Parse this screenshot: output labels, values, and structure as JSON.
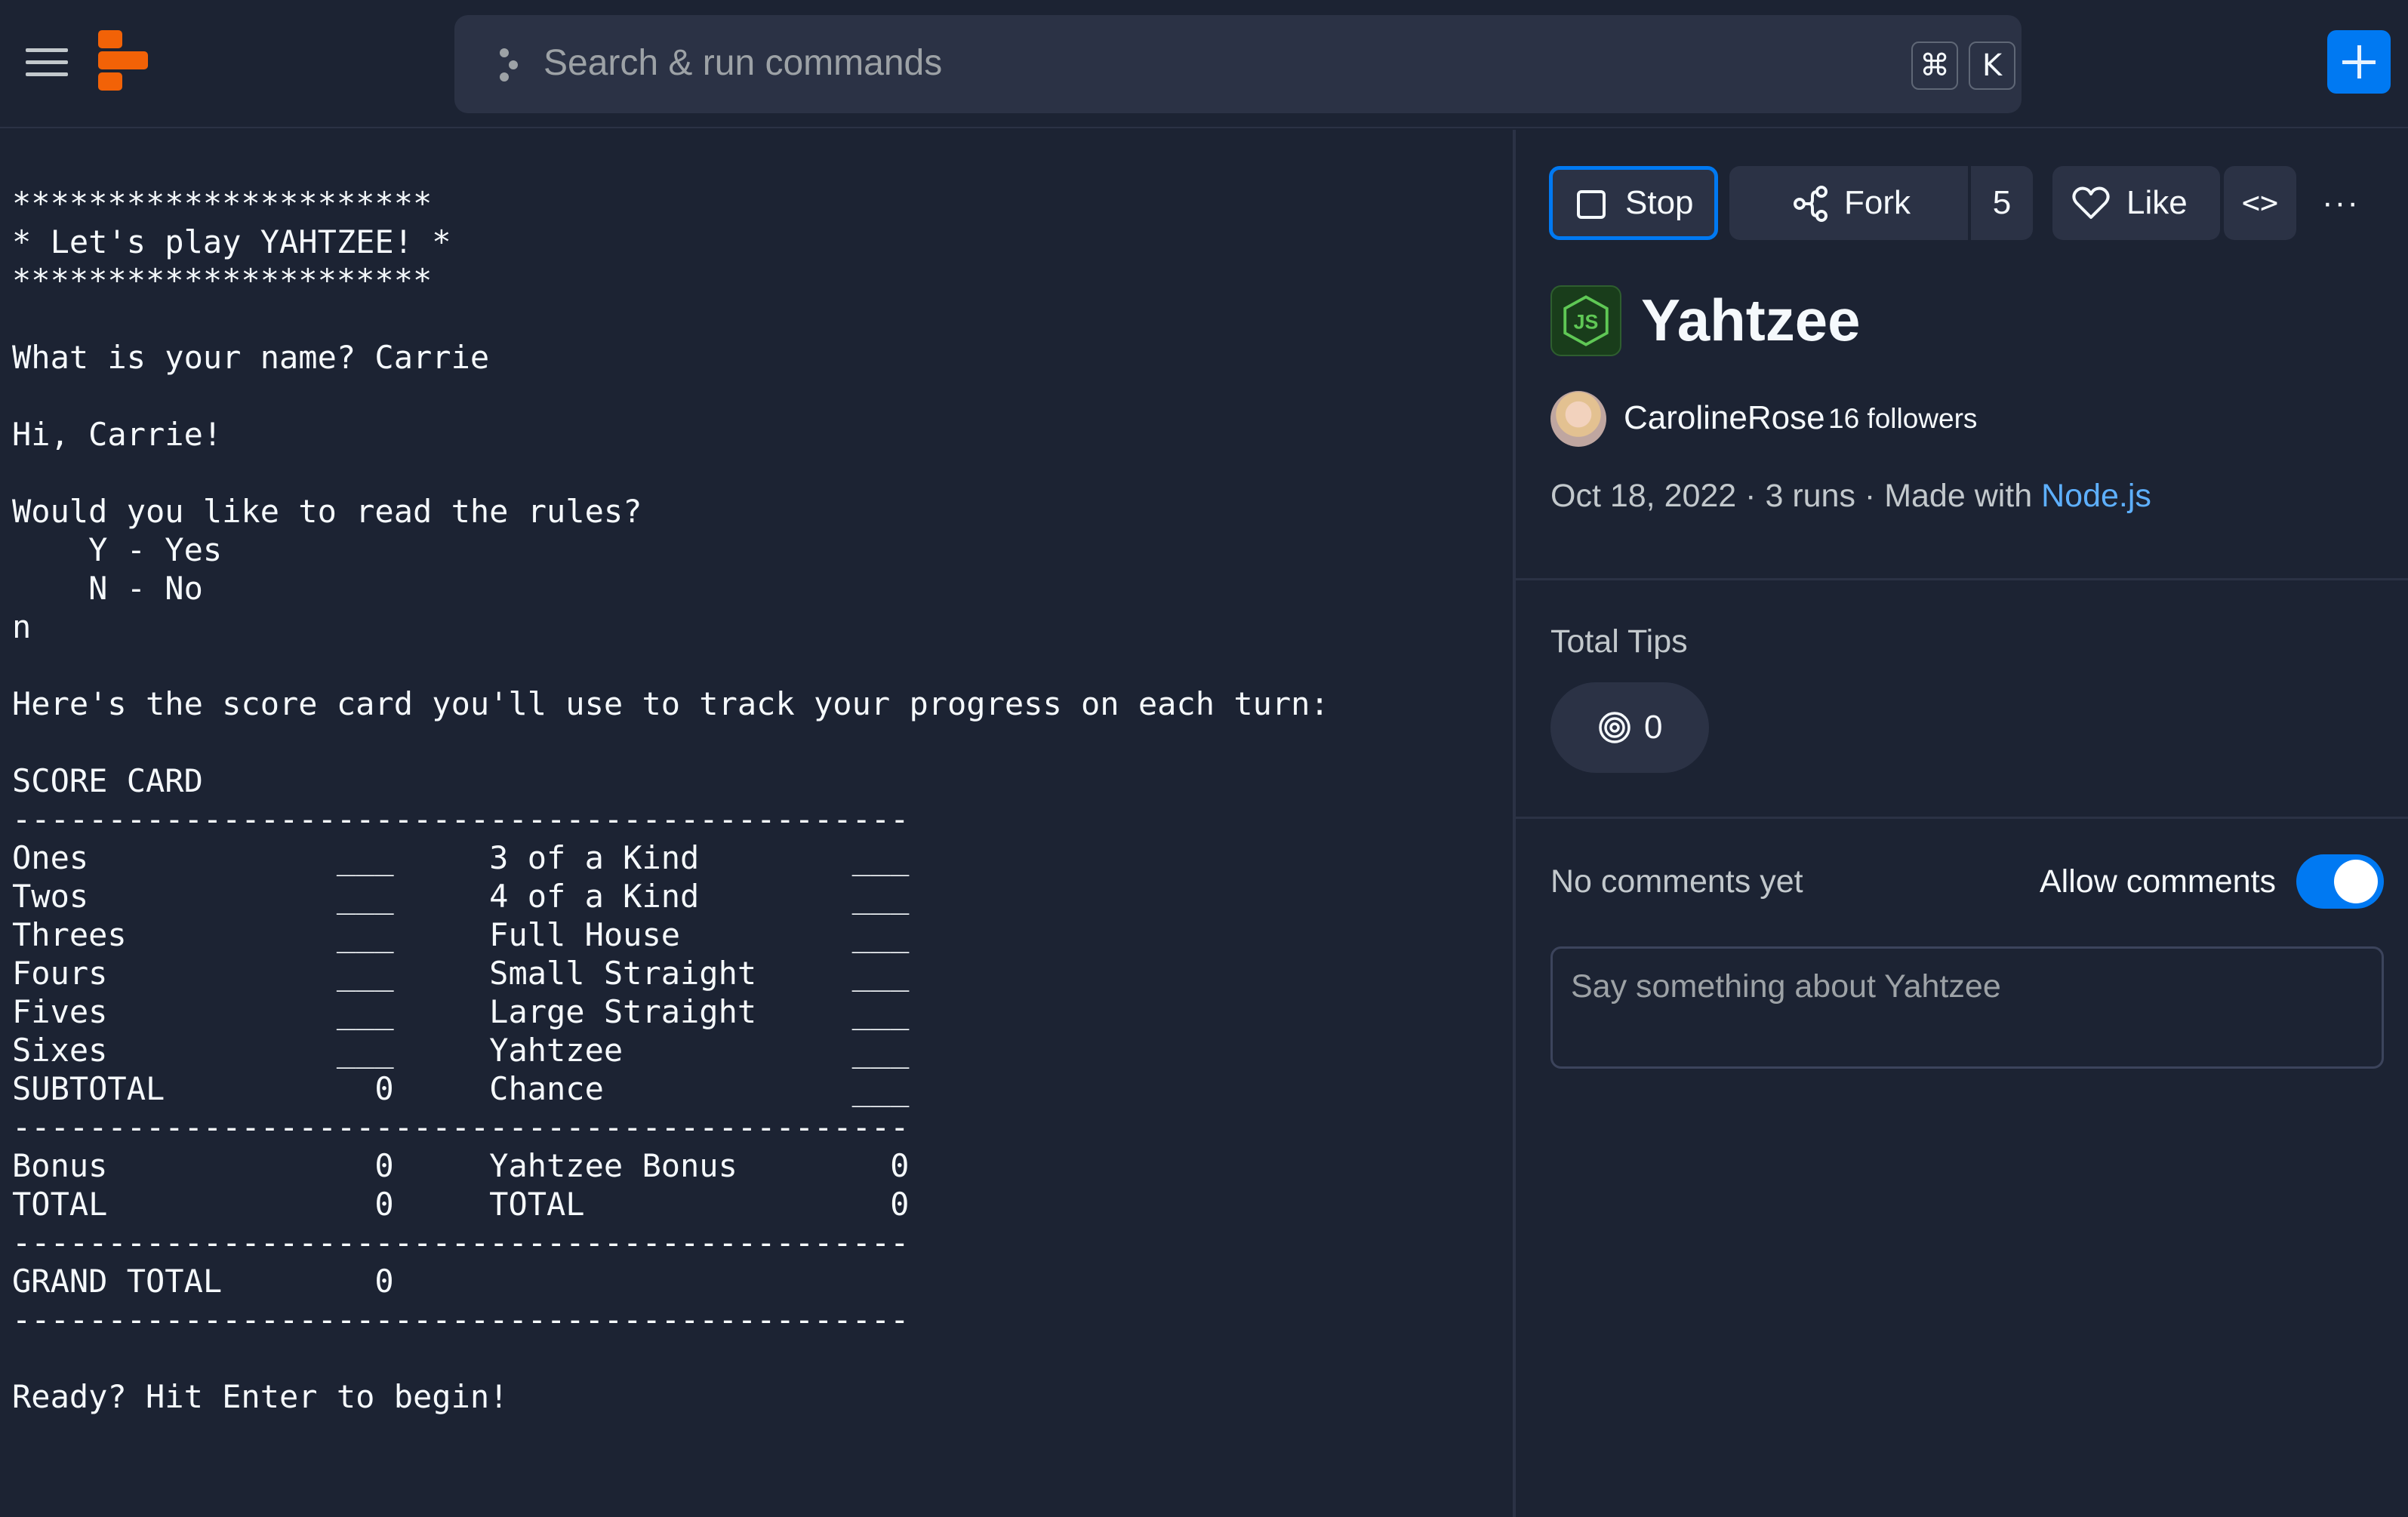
{
  "topbar": {
    "search_placeholder": "Search & run commands",
    "shortcut_keys": [
      "⌘",
      "K"
    ],
    "brand_color": "#f26207",
    "accent_color": "#0079f2"
  },
  "console": {
    "output": "**********************\n* Let's play YAHTZEE! *\n**********************\n\nWhat is your name? Carrie\n\nHi, Carrie!\n\nWould you like to read the rules?\n    Y - Yes\n    N - No\nn\n\nHere's the score card you'll use to track your progress on each turn:\n\nSCORE CARD\n-----------------------------------------------\nOnes             ___     3 of a Kind        ___\nTwos             ___     4 of a Kind        ___\nThrees           ___     Full House         ___\nFours            ___     Small Straight     ___\nFives            ___     Large Straight     ___\nSixes            ___     Yahtzee            ___\nSUBTOTAL           0     Chance             ___\n-----------------------------------------------\nBonus              0     Yahtzee Bonus        0\nTOTAL              0     TOTAL                0\n-----------------------------------------------\nGRAND TOTAL        0\n-----------------------------------------------\n\nReady? Hit Enter to begin!"
  },
  "panel": {
    "buttons": {
      "stop": "Stop",
      "fork": "Fork",
      "fork_count": "5",
      "like": "Like",
      "embed": "<>",
      "more": "···"
    },
    "title": "Yahtzee",
    "language_icon": "nodejs-icon",
    "author": "CarolineRose",
    "followers": "16 followers",
    "meta": {
      "date": "Oct 18, 2022",
      "separator": " · ",
      "runs": "3 runs",
      "made_with": "Made with ",
      "language": "Node.js"
    },
    "tips": {
      "label": "Total Tips",
      "count": "0"
    },
    "comments": {
      "empty_text": "No comments yet",
      "allow_label": "Allow comments",
      "allow_enabled": true,
      "placeholder": "Say something about Yahtzee"
    }
  }
}
